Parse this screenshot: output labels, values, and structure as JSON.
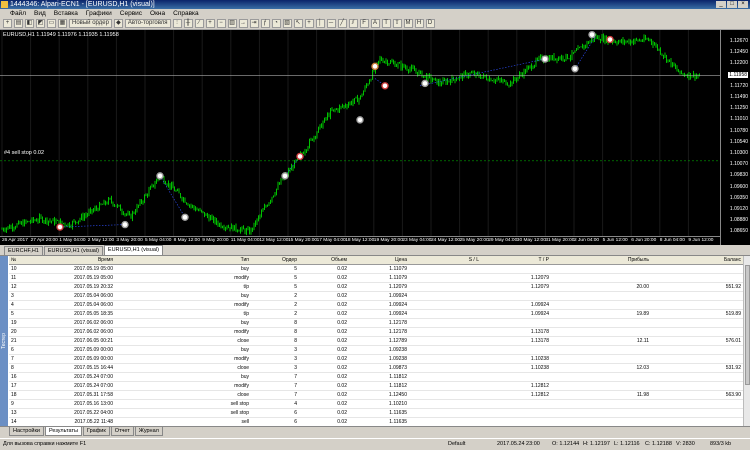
{
  "window": {
    "title": "1444346: Alpari-ECN1 - [EURUSD,H1 (visual)]"
  },
  "menu": [
    "Файл",
    "Вид",
    "Вставка",
    "Графики",
    "Сервис",
    "Окна",
    "Справка"
  ],
  "toolbar": {
    "new_order": "Новый ордер",
    "auto_trading": "Авто-торговля"
  },
  "chart": {
    "symbol_line": "EURUSD,H1  1.11949 1.11976 1.11935 1.11958",
    "sl_label": "#4 sell stop 0.02",
    "price_labels": [
      "1.12670",
      "1.12450",
      "1.12200",
      "1.11958",
      "1.11720",
      "1.11490",
      "1.11250",
      "1.11010",
      "1.10780",
      "1.10540",
      "1.10300",
      "1.10070",
      "1.09830",
      "1.09600",
      "1.09350",
      "1.09120",
      "1.08880",
      "1.08650"
    ],
    "time_labels": [
      "26 Apr 2017",
      "27 Apr 20:00",
      "1 May 04:00",
      "2 May 12:00",
      "3 May 20:00",
      "5 May 04:00",
      "8 May 12:00",
      "9 May 20:00",
      "11 May 04:00",
      "12 May 12:00",
      "15 May 20:00",
      "17 May 04:00",
      "18 May 12:00",
      "19 May 20:00",
      "23 May 04:00",
      "24 May 12:00",
      "25 May 20:00",
      "29 May 04:00",
      "30 May 12:00",
      "31 May 20:00",
      "2 Jun 04:00",
      "5 Jun 12:00",
      "6 Jun 20:00",
      "8 Jun 04:00",
      "9 Jun 12:00"
    ]
  },
  "chart_tabs": [
    "EURCHF,H1",
    "EURUSD,H1 (visual)",
    "EURUSD,H1 (visual)"
  ],
  "columns": [
    "№",
    "Время",
    "Тип",
    "Ордер",
    "Объем",
    "Цена",
    "S / L",
    "T / P",
    "Прибыль",
    "Баланс"
  ],
  "rows": [
    [
      "10",
      "2017.05.19 05:00",
      "buy",
      "5",
      "0.02",
      "1.11079",
      "",
      "",
      "",
      ""
    ],
    [
      "11",
      "2017.05.19 05:00",
      "modify",
      "5",
      "0.02",
      "1.11079",
      "",
      "1.12079",
      "",
      ""
    ],
    [
      "12",
      "2017.05.19 20:32",
      "t/p",
      "5",
      "0.02",
      "1.12079",
      "",
      "1.12079",
      "20.00",
      "551.92"
    ],
    [
      "3",
      "2017.05.04 06:00",
      "buy",
      "2",
      "0.02",
      "1.09924",
      "",
      "",
      "",
      ""
    ],
    [
      "4",
      "2017.05.04 06:00",
      "modify",
      "2",
      "0.02",
      "1.09924",
      "",
      "1.09924",
      "",
      ""
    ],
    [
      "5",
      "2017.05.05 18:35",
      "t/p",
      "2",
      "0.02",
      "1.09924",
      "",
      "1.09924",
      "19.89",
      "519.89"
    ],
    [
      "19",
      "2017.06.02 06:00",
      "buy",
      "8",
      "0.02",
      "1.12178",
      "",
      "",
      "",
      ""
    ],
    [
      "20",
      "2017.06.02 06:00",
      "modify",
      "8",
      "0.02",
      "1.12178",
      "",
      "1.13178",
      "",
      ""
    ],
    [
      "21",
      "2017.06.05 00:21",
      "close",
      "8",
      "0.02",
      "1.12789",
      "",
      "1.13178",
      "12.11",
      "576.01"
    ],
    [
      "6",
      "2017.05.09 00:00",
      "buy",
      "3",
      "0.02",
      "1.09238",
      "",
      "",
      "",
      ""
    ],
    [
      "7",
      "2017.05.09 00:00",
      "modify",
      "3",
      "0.02",
      "1.09238",
      "",
      "1.10238",
      "",
      ""
    ],
    [
      "8",
      "2017.05.15 16:44",
      "close",
      "3",
      "0.02",
      "1.09873",
      "",
      "1.10238",
      "12.03",
      "531.92"
    ],
    [
      "16",
      "2017.05.24 07:00",
      "buy",
      "7",
      "0.02",
      "1.11812",
      "",
      "",
      "",
      ""
    ],
    [
      "17",
      "2017.05.24 07:00",
      "modify",
      "7",
      "0.02",
      "1.11812",
      "",
      "1.12812",
      "",
      ""
    ],
    [
      "18",
      "2017.05.31 17:58",
      "close",
      "7",
      "0.02",
      "1.12450",
      "",
      "1.12812",
      "11.98",
      "563.90"
    ],
    [
      "9",
      "2017.05.16 13:00",
      "sell stop",
      "4",
      "0.02",
      "1.10210",
      "",
      "",
      "",
      ""
    ],
    [
      "13",
      "2017.05.22 04:00",
      "sell stop",
      "6",
      "0.02",
      "1.11635",
      "",
      "",
      "",
      ""
    ],
    [
      "14",
      "2017.05.22 11:48",
      "sell",
      "6",
      "0.02",
      "1.11635",
      "",
      "",
      "",
      ""
    ]
  ],
  "terminal_tabs": [
    "Настройки",
    "Результаты",
    "График",
    "Отчет",
    "Журнал"
  ],
  "terminal_label": "Тестер",
  "status": {
    "help": "Для вызова справки нажмите F1",
    "profile": "Default",
    "time": "2017.05.24 23:00",
    "open": "O: 1.12144",
    "high": "H: 1.12197",
    "low": "L: 1.12116",
    "close": "C: 1.12188",
    "volume": "V: 2830",
    "traffic": "893/3 kb"
  },
  "colors": {
    "candles": "#00c000",
    "chart_bg": "#000000",
    "grid": "#3a3a3a"
  }
}
